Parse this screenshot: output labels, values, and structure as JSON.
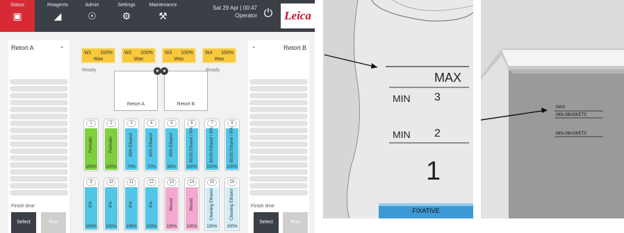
{
  "header": {
    "tabs": [
      {
        "label": "Status",
        "icon": "status-icon",
        "glyph": "▣",
        "active": true
      },
      {
        "label": "Reagents",
        "icon": "reagents-icon",
        "glyph": "◢"
      },
      {
        "label": "Admin",
        "icon": "admin-icon",
        "glyph": "☉"
      },
      {
        "label": "Settings",
        "icon": "settings-icon",
        "glyph": "⚙"
      },
      {
        "label": "Maintenance",
        "icon": "maintenance-icon",
        "glyph": "⚒"
      }
    ],
    "datetime": "Sat 29 Apr | 00:47",
    "user": "Operator",
    "power_glyph": "⏻",
    "logo": "Leica",
    "accent_color": "#d82a35"
  },
  "retort_a_panel": {
    "title": "Retort A",
    "arrow": "▸",
    "finish_label": "Finish time",
    "select_label": "Select",
    "run_label": "Run"
  },
  "retort_b_panel": {
    "title": "Retort B",
    "arrow": "◂",
    "finish_label": "Finish time",
    "select_label": "Select",
    "run_label": "Run"
  },
  "wax_baths": [
    {
      "name": "W1",
      "percent": "100%",
      "reagent": "Wax"
    },
    {
      "name": "W2",
      "percent": "100%",
      "reagent": "Wax"
    },
    {
      "name": "W3",
      "percent": "100%",
      "reagent": "Wax"
    },
    {
      "name": "W4",
      "percent": "100%",
      "reagent": "Wax"
    }
  ],
  "retorts": [
    {
      "label": "Retort A",
      "status": "Ready"
    },
    {
      "label": "Retort B",
      "status": "Ready"
    }
  ],
  "bottles_top": [
    {
      "number": "1",
      "reagent": "Formalin",
      "percent": "100%",
      "color": "#7fcf3f"
    },
    {
      "number": "2",
      "reagent": "Formalin",
      "percent": "100%",
      "color": "#7fcf3f"
    },
    {
      "number": "3",
      "reagent": "85% Ethanol",
      "percent": "70%",
      "color": "#52c6e6"
    },
    {
      "number": "4",
      "reagent": "85% Ethanol",
      "percent": "70%",
      "color": "#52c6e6"
    },
    {
      "number": "5",
      "reagent": "85% Ethanol",
      "percent": "85%",
      "color": "#52c6e6"
    },
    {
      "number": "6",
      "reagent": "80/20 Ethanol / IPA",
      "percent": "100%",
      "color": "#52c6e6"
    },
    {
      "number": "7",
      "reagent": "80/20 Ethanol / IPA",
      "percent": "100%",
      "color": "#52c6e6"
    },
    {
      "number": "8",
      "reagent": "80/20 Ethanol / IPA",
      "percent": "100%",
      "color": "#52c6e6"
    }
  ],
  "bottles_bottom": [
    {
      "number": "9",
      "reagent": "IPA",
      "percent": "100%",
      "color": "#52c6e6"
    },
    {
      "number": "10",
      "reagent": "IPA",
      "percent": "100%",
      "color": "#52c6e6"
    },
    {
      "number": "11",
      "reagent": "IPA",
      "percent": "100%",
      "color": "#52c6e6"
    },
    {
      "number": "12",
      "reagent": "IPA",
      "percent": "100%",
      "color": "#52c6e6"
    },
    {
      "number": "13",
      "reagent": "Waxed",
      "percent": "100%",
      "color": "#f5a8cf"
    },
    {
      "number": "14",
      "reagent": "Waxed",
      "percent": "100%",
      "color": "#f5a8cf"
    },
    {
      "number": "15",
      "reagent": "Cleaning Ethanol",
      "percent": "100%",
      "color": "#cfeef8"
    },
    {
      "number": "16",
      "reagent": "Cleaning Ethanol",
      "percent": "100%",
      "color": "#cfeef8"
    }
  ],
  "photo_retort": {
    "max": "MAX",
    "min3_label": "MIN",
    "min3_num": "3",
    "min2_label": "MIN",
    "min2_num": "2",
    "big_number": "1",
    "fixative": "FIXATIVE",
    "fixative_color": "#3c9bd6"
  },
  "photo_wax": {
    "max": "MAX",
    "min3": "MIN-3BASKETS",
    "min2": "MIN-2BASKETS"
  }
}
